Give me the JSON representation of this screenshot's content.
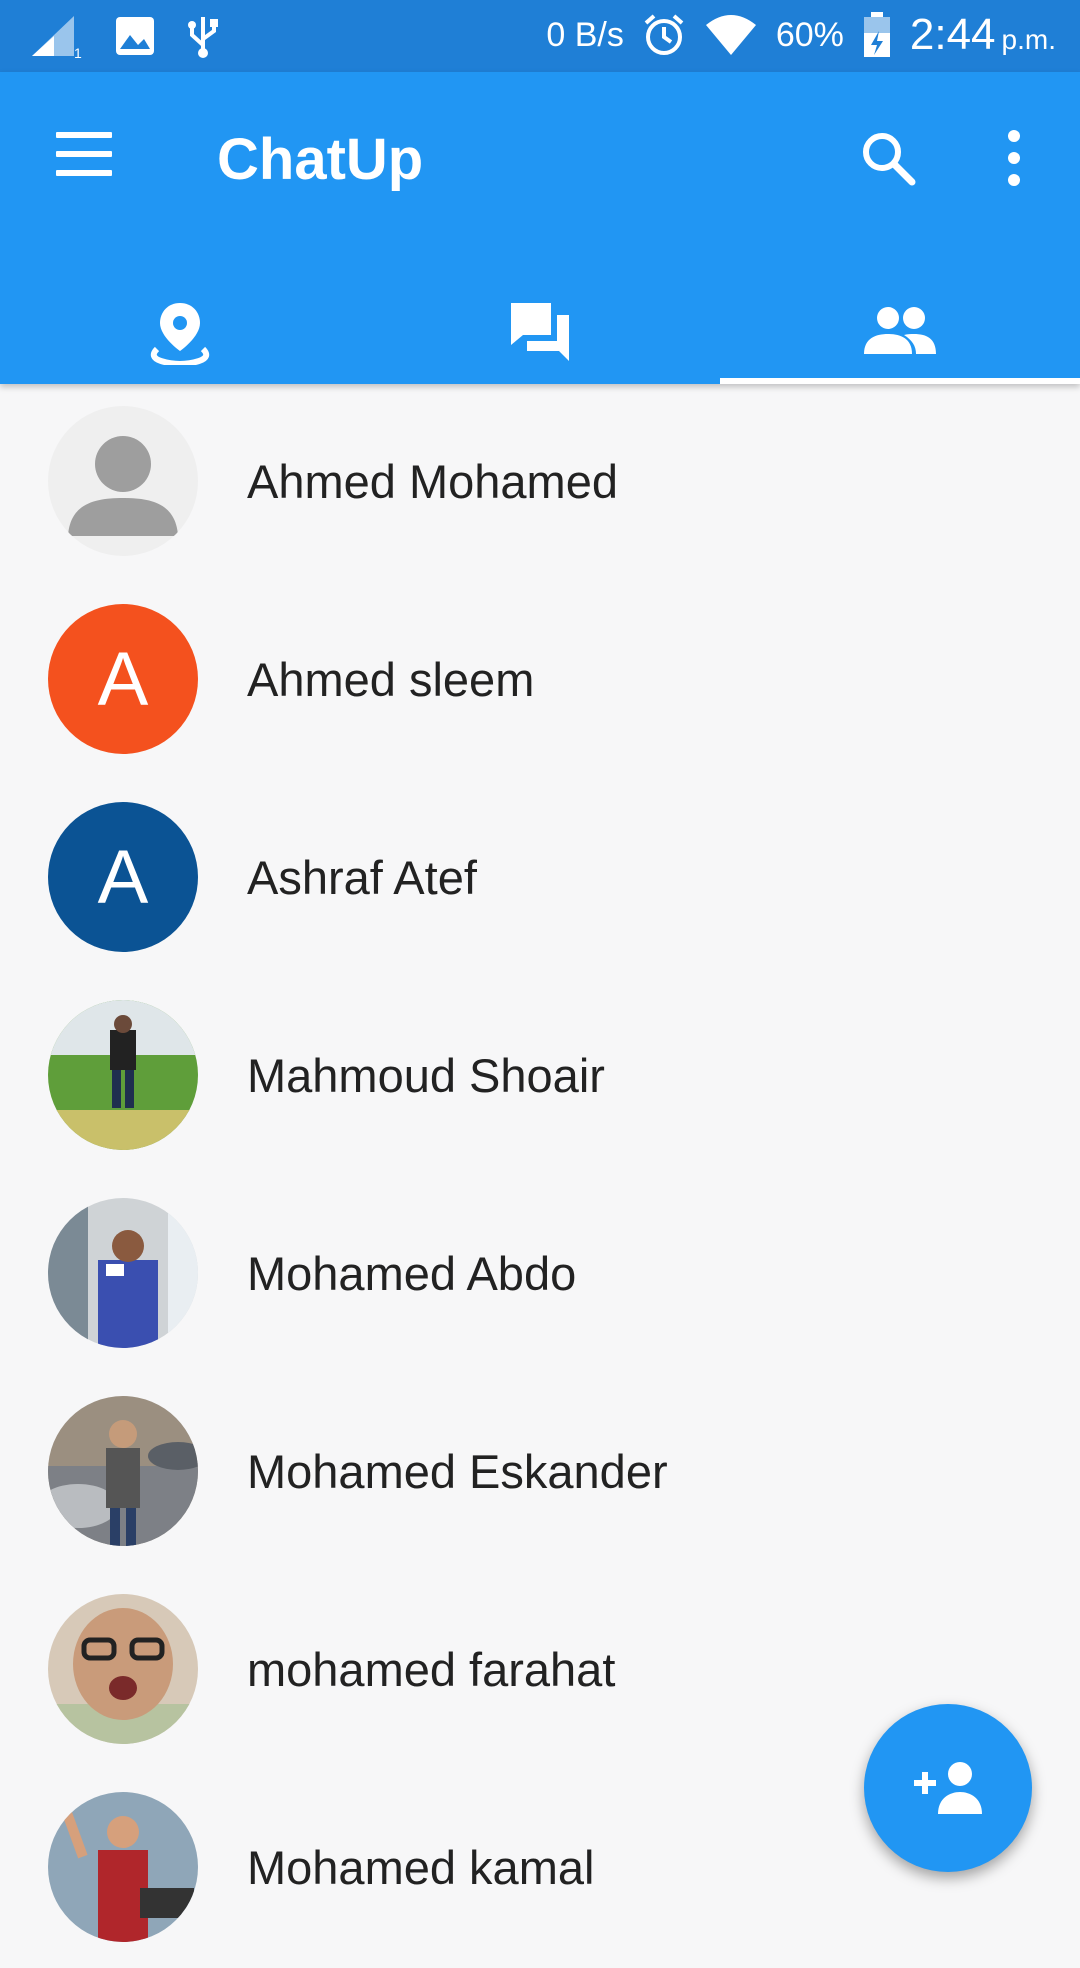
{
  "status_bar": {
    "net_speed": "0 B/s",
    "battery": "60%",
    "time": "2:44",
    "ampm": "p.m.",
    "icons": [
      "signal-icon",
      "image-icon",
      "usb-icon",
      "alarm-icon",
      "wifi-icon",
      "battery-icon"
    ]
  },
  "app_bar": {
    "title": "ChatUp",
    "menu_icon": "menu-icon",
    "search_icon": "search-icon",
    "overflow_icon": "more-vert-icon"
  },
  "tabs": [
    {
      "icon": "location-pin-icon",
      "selected": false
    },
    {
      "icon": "chat-bubbles-icon",
      "selected": false
    },
    {
      "icon": "people-icon",
      "selected": true
    }
  ],
  "colors": {
    "primary": "#2196f3",
    "status_bar": "#1f7fd6",
    "background": "#f7f7f8",
    "avatar_orange": "#f4511e",
    "avatar_blue": "#0b5394"
  },
  "contacts": [
    {
      "name": "Ahmed Mohamed",
      "avatar_type": "placeholder",
      "avatar_letter": ""
    },
    {
      "name": "Ahmed sleem",
      "avatar_type": "letter",
      "avatar_letter": "A",
      "avatar_color": "#f4511e"
    },
    {
      "name": "Ashraf Atef",
      "avatar_type": "letter",
      "avatar_letter": "A",
      "avatar_color": "#0b5394"
    },
    {
      "name": "Mahmoud Shoair",
      "avatar_type": "photo",
      "avatar_letter": ""
    },
    {
      "name": "Mohamed Abdo",
      "avatar_type": "photo",
      "avatar_letter": ""
    },
    {
      "name": "Mohamed Eskander",
      "avatar_type": "photo",
      "avatar_letter": ""
    },
    {
      "name": "mohamed farahat",
      "avatar_type": "photo",
      "avatar_letter": ""
    },
    {
      "name": "Mohamed kamal",
      "avatar_type": "photo",
      "avatar_letter": ""
    }
  ],
  "fab": {
    "icon": "add-person-icon"
  }
}
